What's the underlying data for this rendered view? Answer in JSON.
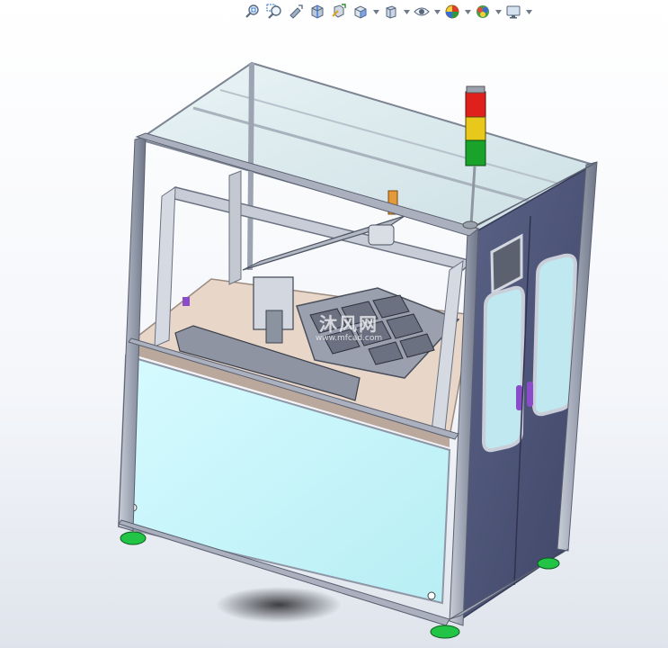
{
  "toolbar": {
    "items": [
      {
        "name": "zoom-to-fit-icon",
        "dropdown": false
      },
      {
        "name": "zoom-to-area-icon",
        "dropdown": false
      },
      {
        "name": "previous-view-icon",
        "dropdown": false
      },
      {
        "name": "section-view-icon",
        "dropdown": false
      },
      {
        "name": "dynamic-annotation-icon",
        "dropdown": false
      },
      {
        "name": "view-orientation-icon",
        "dropdown": true
      },
      {
        "name": "display-style-icon",
        "dropdown": true
      },
      {
        "name": "hide-show-items-icon",
        "dropdown": true
      },
      {
        "name": "edit-appearance-icon",
        "dropdown": true
      },
      {
        "name": "apply-scene-icon",
        "dropdown": true
      },
      {
        "name": "view-settings-icon",
        "dropdown": true
      }
    ]
  },
  "watermark": {
    "main": "沐风网",
    "sub": "www.mfcad.com"
  },
  "colors": {
    "frame": "#8f96a6",
    "side_panel": "#4e5678",
    "front_panel": "#ccf7fb",
    "deck": "#e8d6c8",
    "glass": "#cfe4e8",
    "feet": "#22c445",
    "tower_red": "#e0201c",
    "tower_yellow": "#e8c81a",
    "tower_green": "#1aa32a"
  }
}
